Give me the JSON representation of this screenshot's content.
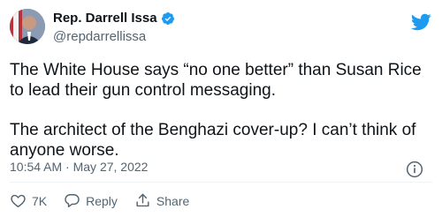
{
  "author": {
    "name": "Rep. Darrell Issa",
    "handle": "@repdarrellissa",
    "verified": true
  },
  "tweet": {
    "paragraph_1": "The White House says “no one better” than Susan Rice to lead their gun control messaging.",
    "paragraph_2": "The architect of the Benghazi cover-up? I can’t think of anyone worse."
  },
  "meta": {
    "time": "10:54 AM",
    "separator": "·",
    "date": "May 27, 2022"
  },
  "actions": {
    "like_count": "7K",
    "reply_label": "Reply",
    "share_label": "Share"
  },
  "icons": {
    "logo": "twitter-bird-icon",
    "verified": "verified-badge-icon",
    "info": "info-icon",
    "like": "heart-icon",
    "reply": "reply-icon",
    "share": "share-icon"
  },
  "colors": {
    "brand_blue": "#1d9bf0",
    "text_primary": "#0f1419",
    "text_secondary": "#536471"
  }
}
